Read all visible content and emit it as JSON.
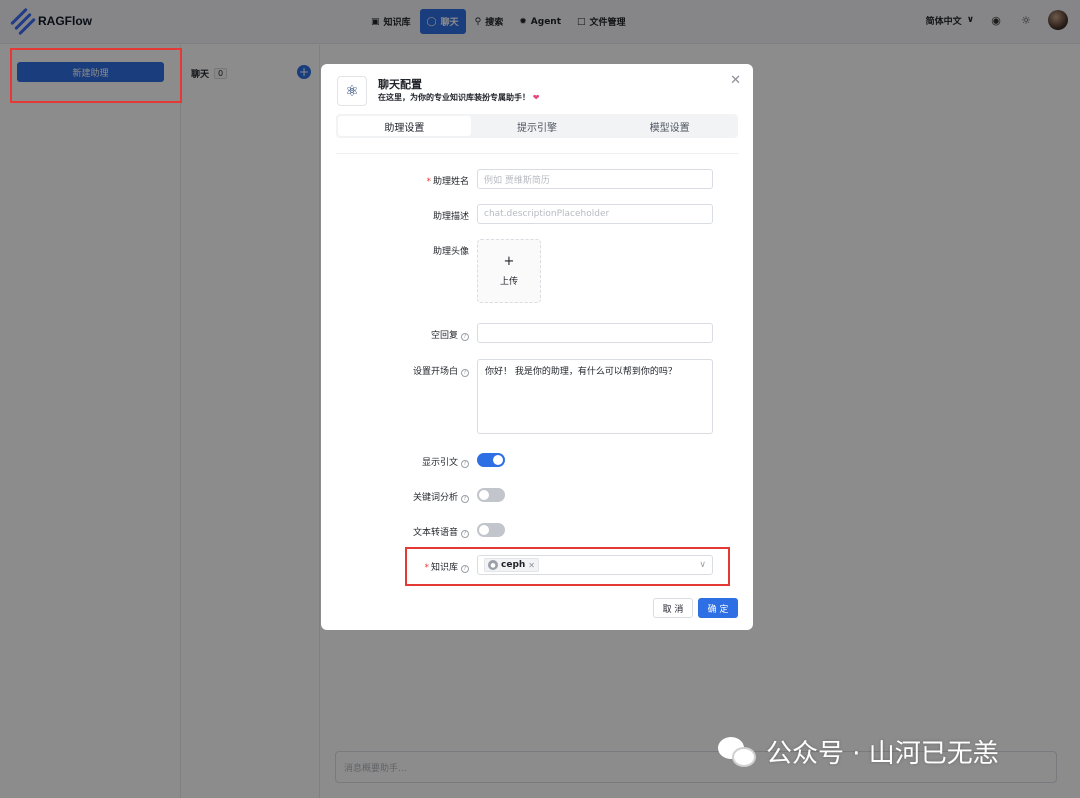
{
  "app": {
    "name": "RAGFlow"
  },
  "nav": [
    {
      "label": "知识库",
      "icon": "database-icon",
      "active": false
    },
    {
      "label": "聊天",
      "icon": "chat-icon",
      "active": true
    },
    {
      "label": "搜索",
      "icon": "search-icon",
      "active": false
    },
    {
      "label": "Agent",
      "icon": "agent-icon",
      "active": false
    },
    {
      "label": "文件管理",
      "icon": "folder-icon",
      "active": false
    }
  ],
  "header_right": {
    "language": "简体中文"
  },
  "sidebar": {
    "new_assistant_label": "新建助理"
  },
  "chat_panel": {
    "title": "聊天",
    "count": "0"
  },
  "message_input": {
    "placeholder": "消息概要助手..."
  },
  "modal": {
    "title": "聊天配置",
    "subtitle": "在这里，为你的专业知识库装扮专属助手！",
    "tabs": [
      "助理设置",
      "提示引擎",
      "模型设置"
    ],
    "active_tab": 0,
    "fields": {
      "name": {
        "label": "助理姓名",
        "placeholder": "例如 贾维斯简历",
        "required": true
      },
      "description": {
        "label": "助理描述",
        "placeholder": "chat.descriptionPlaceholder"
      },
      "avatar": {
        "label": "助理头像",
        "upload_label": "上传"
      },
      "empty_response": {
        "label": "空回复",
        "value": ""
      },
      "opener": {
        "label": "设置开场白",
        "value": "你好！ 我是你的助理，有什么可以帮到你的吗？"
      },
      "show_quote": {
        "label": "显示引文",
        "enabled": true
      },
      "keyword_analysis": {
        "label": "关键词分析",
        "enabled": false
      },
      "tts": {
        "label": "文本转语音",
        "enabled": false
      },
      "knowledge_base": {
        "label": "知识库",
        "required": true,
        "selected": [
          "ceph"
        ]
      }
    },
    "cancel_label": "取 消",
    "ok_label": "确 定"
  },
  "watermark": {
    "text": "公众号 · 山河已无恙"
  },
  "colors": {
    "accent": "#2f6fe4",
    "highlight_box": "#e53935"
  }
}
